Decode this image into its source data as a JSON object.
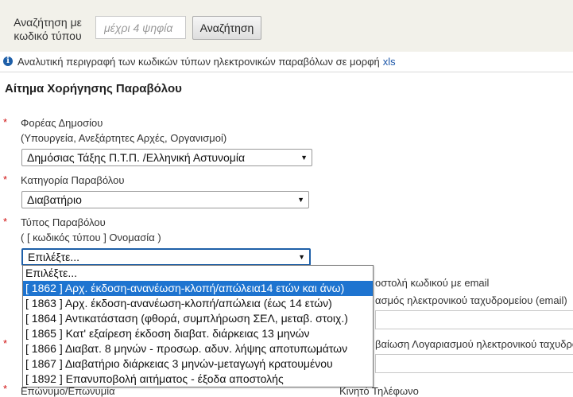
{
  "search": {
    "label": "Αναζήτηση με κωδικό τύπου",
    "placeholder": "μέχρι 4 ψηφία",
    "button_label": "Αναζήτηση"
  },
  "info": {
    "icon": "info-icon",
    "text": "Αναλυτική περιγραφή των κωδικών τύπων ηλεκτρονικών παραβόλων σε μορφή",
    "link_label": "xls"
  },
  "form": {
    "title": "Αίτημα Χορήγησης Παραβόλου",
    "required_mark": "*",
    "public_body": {
      "label": "Φορέας Δημοσίου",
      "sublabel": "(Υπουργεία, Ανεξάρτητες Αρχές, Οργανισμοί)",
      "value": "Δημόσιας Τάξης Π.Τ.Π. /Ελληνική Αστυνομία"
    },
    "category": {
      "label": "Κατηγορία Παραβόλου",
      "value": "Διαβατήριο"
    },
    "fee_type": {
      "label": "Τύπος Παραβόλου",
      "sublabel": "( [ κωδικός τύπου ] Ονομασία )",
      "value": "Επιλέξτε...",
      "options": [
        "Επιλέξτε...",
        "[ 1862 ] Αρχ. έκδοση-ανανέωση-κλοπή/απώλεια14 ετών και άνω)",
        "[ 1863 ] Αρχ. έκδοση-ανανέωση-κλοπή/απώλεια (έως 14 ετών)",
        "[ 1864 ] Αντικατάσταση (φθορά, συμπλήρωση ΣΕΛ, μεταβ. στοιχ.)",
        "[ 1865 ] Κατ' εξαίρεση έκδοση διαβατ. διάρκειας 13 μηνών",
        "[ 1866 ] Διαβατ. 8 μηνών - προσωρ. αδυν. λήψης αποτυπωμάτων",
        "[ 1867 ] Διαβατήριο διάρκειας 3 μηνών-μεταγωγή κρατουμένου",
        "[ 1892 ] Επανυποβολή αιτήματος - έξοδα αποστολής"
      ],
      "selected_index": 1
    },
    "background": {
      "email_send": "οστολή κωδικού με email",
      "email_address": "ασμός ηλεκτρονικού ταχυδρομείου (email)",
      "confirm_email": "βαίωση Λογαριασμού ηλεκτρονικού ταχυδρομ",
      "surname_label": "Επώνυμο/Επωνυμία",
      "mobile_label": "Κινητό Τηλέφωνο"
    }
  }
}
